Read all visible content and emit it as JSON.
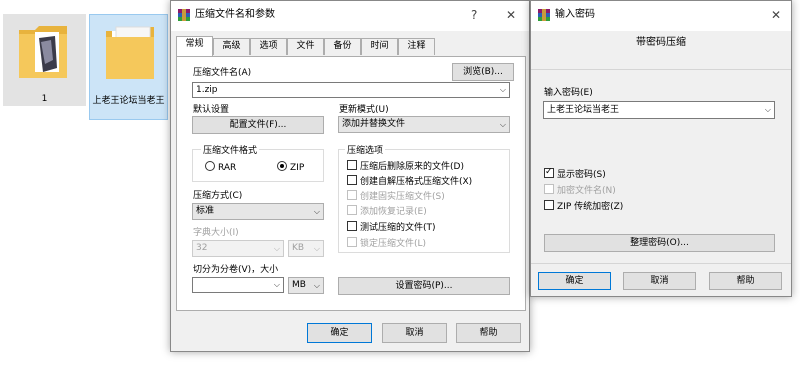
{
  "desktop": {
    "files": [
      {
        "label": "1"
      },
      {
        "label": "上老王论坛当老王"
      }
    ]
  },
  "main_dialog": {
    "title": "压缩文件名和参数",
    "title_help": "?",
    "title_close": "✕",
    "tabs": [
      "常规",
      "高级",
      "选项",
      "文件",
      "备份",
      "时间",
      "注释"
    ],
    "archive_name_label": "压缩文件名(A)",
    "archive_name_value": "1.zip",
    "browse_button": "浏览(B)...",
    "default_settings_label": "默认设置",
    "profiles_button": "配置文件(F)...",
    "update_mode_label": "更新模式(U)",
    "update_mode_value": "添加并替换文件",
    "format_group_label": "压缩文件格式",
    "format_options": [
      "RAR",
      "ZIP"
    ],
    "format_selected": "ZIP",
    "method_label": "压缩方式(C)",
    "method_value": "标准",
    "dict_label": "字典大小(I)",
    "dict_value": "32",
    "dict_unit": "KB",
    "split_label": "切分为分卷(V)，大小",
    "split_value": "",
    "split_unit": "MB",
    "options_group_label": "压缩选项",
    "options": [
      {
        "label": "压缩后删除原来的文件(D)",
        "checked": false,
        "enabled": true
      },
      {
        "label": "创建自解压格式压缩文件(X)",
        "checked": false,
        "enabled": true
      },
      {
        "label": "创建固实压缩文件(S)",
        "checked": false,
        "enabled": false
      },
      {
        "label": "添加恢复记录(E)",
        "checked": false,
        "enabled": false
      },
      {
        "label": "测试压缩的文件(T)",
        "checked": false,
        "enabled": true
      },
      {
        "label": "锁定压缩文件(L)",
        "checked": false,
        "enabled": false
      }
    ],
    "set_password_button": "设置密码(P)...",
    "ok_button": "确定",
    "cancel_button": "取消",
    "help_button": "帮助"
  },
  "password_dialog": {
    "title": "输入密码",
    "title_close": "✕",
    "heading": "带密码压缩",
    "password_label": "输入密码(E)",
    "password_value": "上老王论坛当老王",
    "options": [
      {
        "label": "显示密码(S)",
        "checked": true,
        "enabled": true
      },
      {
        "label": "加密文件名(N)",
        "checked": false,
        "enabled": false
      },
      {
        "label": "ZIP 传统加密(Z)",
        "checked": false,
        "enabled": true
      }
    ],
    "organize_button": "整理密码(O)...",
    "ok_button": "确定",
    "cancel_button": "取消",
    "help_button": "帮助"
  },
  "colors": {
    "accent": "#0078d7",
    "selection": "#cce4f7",
    "folder": "#f5c85b"
  },
  "icons": {
    "app": "winrar-icon",
    "folder": "folder-icon",
    "dropdown": "chevron-down-icon",
    "check": "check-icon"
  }
}
